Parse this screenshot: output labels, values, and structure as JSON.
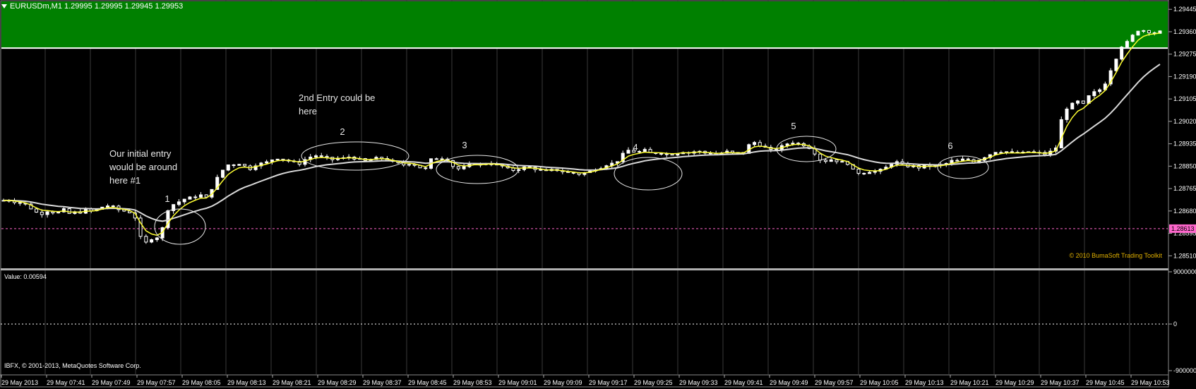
{
  "window": {
    "symbol_line": "EURUSDm,M1  1.29995 1.29995 1.29945 1.29953"
  },
  "annotations": {
    "initial_entry": [
      "Our initial entry",
      "would be around",
      "here #1"
    ],
    "second_entry": [
      "2nd Entry could be",
      "here"
    ],
    "ellipse_labels": [
      "1",
      "2",
      "3",
      "4",
      "5",
      "6"
    ]
  },
  "copyright": "© 2010 BumaSoft Trading Toolkit",
  "indicator": {
    "value_label": "Value: 0.00594",
    "axis_labels": [
      "9000000",
      "0",
      "-9000000"
    ]
  },
  "footer": {
    "vendor": "IBFX, © 2001-2013, MetaQuotes Software Corp."
  },
  "price_axis": {
    "labels": [
      "1.29445",
      "1.29360",
      "1.29275",
      "1.29190",
      "1.29105",
      "1.29020",
      "1.28935",
      "1.28850",
      "1.28765",
      "1.28680",
      "1.28595",
      "1.28510"
    ],
    "current_price_label": "1.28613"
  },
  "time_axis": {
    "labels": [
      "29 May 2013",
      "29 May 07:41",
      "29 May 07:49",
      "29 May 07:57",
      "29 May 08:05",
      "29 May 08:13",
      "29 May 08:21",
      "29 May 08:29",
      "29 May 08:37",
      "29 May 08:45",
      "29 May 08:53",
      "29 May 09:01",
      "29 May 09:09",
      "29 May 09:17",
      "29 May 09:25",
      "29 May 09:33",
      "29 May 09:41",
      "29 May 09:49",
      "29 May 09:57",
      "29 May 10:05",
      "29 May 10:13",
      "29 May 10:21",
      "29 May 10:29",
      "29 May 10:37",
      "29 May 10:45",
      "29 May 10:53"
    ]
  },
  "colors": {
    "background": "#000000",
    "grid": "#3a3a3a",
    "green_zone": "#008000",
    "bull_candle": "#ffffff",
    "bear_candle": "#000000",
    "fast_ma": "#ffff33",
    "slow_ma": "#d9d9d9",
    "price_line": "#ff66cc",
    "copyright_text": "#e0b000"
  },
  "chart_data": {
    "type": "candlestick",
    "price_range": [
      1.28468,
      1.29475
    ],
    "green_zone_bottom": 1.29298,
    "current_price": 1.28613,
    "mid_prices": [
      1.2872,
      1.2872,
      1.28715,
      1.2871,
      1.28705,
      1.2869,
      1.28675,
      1.2867,
      1.2868,
      1.28675,
      1.28675,
      1.28685,
      1.2867,
      1.28675,
      1.28675,
      1.28685,
      1.2868,
      1.28685,
      1.28695,
      1.287,
      1.28695,
      1.28685,
      1.2868,
      1.28675,
      1.28655,
      1.2858,
      1.2856,
      1.28575,
      1.2858,
      1.28615,
      1.28685,
      1.28705,
      1.28715,
      1.28725,
      1.2873,
      1.28735,
      1.2874,
      1.2873,
      1.28765,
      1.28805,
      1.28835,
      1.28855,
      1.28855,
      1.2886,
      1.2885,
      1.2884,
      1.28855,
      1.2886,
      1.28865,
      1.28875,
      1.2888,
      1.28875,
      1.2887,
      1.28865,
      1.2886,
      1.28875,
      1.28885,
      1.2889,
      1.28885,
      1.2888,
      1.28875,
      1.2888,
      1.2888,
      1.28885,
      1.2888,
      1.28875,
      1.2887,
      1.28875,
      1.2888,
      1.2888,
      1.28875,
      1.28865,
      1.2886,
      1.28855,
      1.2886,
      1.28855,
      1.28845,
      1.2884,
      1.28875,
      1.2888,
      1.2888,
      1.28875,
      1.2885,
      1.2884,
      1.28845,
      1.28855,
      1.2886,
      1.28855,
      1.2886,
      1.2886,
      1.28855,
      1.2885,
      1.2884,
      1.28835,
      1.2884,
      1.28845,
      1.28845,
      1.2884,
      1.28835,
      1.2883,
      1.28835,
      1.28835,
      1.2883,
      1.28825,
      1.28825,
      1.2882,
      1.28825,
      1.2883,
      1.2884,
      1.28845,
      1.28855,
      1.2886,
      1.2887,
      1.28895,
      1.2891,
      1.28905,
      1.28905,
      1.2891,
      1.289,
      1.289,
      1.289,
      1.28895,
      1.28895,
      1.289,
      1.28905,
      1.289,
      1.28905,
      1.28905,
      1.289,
      1.289,
      1.28895,
      1.289,
      1.28905,
      1.289,
      1.289,
      1.289,
      1.2893,
      1.2894,
      1.2893,
      1.2892,
      1.2891,
      1.28915,
      1.28925,
      1.28935,
      1.2894,
      1.28935,
      1.2893,
      1.2892,
      1.289,
      1.28875,
      1.2887,
      1.28875,
      1.2887,
      1.28865,
      1.2886,
      1.28835,
      1.28825,
      1.28825,
      1.2883,
      1.2883,
      1.28835,
      1.28845,
      1.2886,
      1.28865,
      1.28855,
      1.2885,
      1.2885,
      1.28845,
      1.2885,
      1.2885,
      1.2885,
      1.28855,
      1.2886,
      1.2887,
      1.2887,
      1.28875,
      1.28875,
      1.28865,
      1.28875,
      1.28885,
      1.28895,
      1.28905,
      1.28905,
      1.28905,
      1.289,
      1.289,
      1.289,
      1.28905,
      1.289,
      1.289,
      1.28895,
      1.28905,
      1.2892,
      1.29025,
      1.2907,
      1.29085,
      1.29095,
      1.29085,
      1.29115,
      1.2913,
      1.2914,
      1.29165,
      1.29215,
      1.2926,
      1.29305,
      1.2932,
      1.29345,
      1.29365,
      1.29365,
      1.2936,
      1.29355,
      1.2936
    ]
  }
}
